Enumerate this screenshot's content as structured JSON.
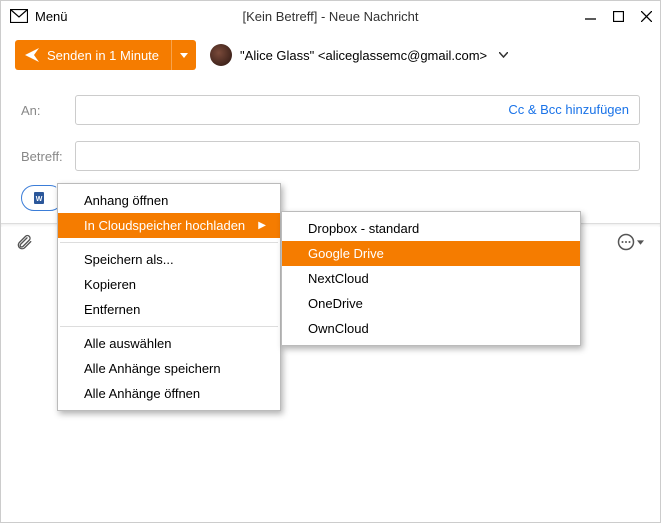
{
  "titlebar": {
    "menu_label": "Menü",
    "title": "[Kein Betreff] - Neue Nachricht"
  },
  "toolbar": {
    "send_label": "Senden in 1 Minute",
    "from_display": "\"Alice Glass\" <aliceglassemc@gmail.com>"
  },
  "fields": {
    "to_label": "An:",
    "subject_label": "Betreff:",
    "ccbcc_label": "Cc & Bcc hinzufügen"
  },
  "context_menu_1": {
    "items": [
      {
        "label": "Anhang öffnen"
      },
      {
        "label": "In Cloudspeicher hochladen",
        "submenu": true,
        "highlighted": true
      },
      {
        "sep": true
      },
      {
        "label": "Speichern als..."
      },
      {
        "label": "Kopieren"
      },
      {
        "label": "Entfernen"
      },
      {
        "sep": true
      },
      {
        "label": "Alle auswählen"
      },
      {
        "label": "Alle Anhänge speichern"
      },
      {
        "label": "Alle Anhänge öffnen"
      }
    ]
  },
  "context_menu_2": {
    "items": [
      {
        "label": "Dropbox - standard"
      },
      {
        "label": "Google Drive",
        "highlighted": true
      },
      {
        "label": "NextCloud"
      },
      {
        "label": "OneDrive"
      },
      {
        "label": "OwnCloud"
      }
    ]
  }
}
